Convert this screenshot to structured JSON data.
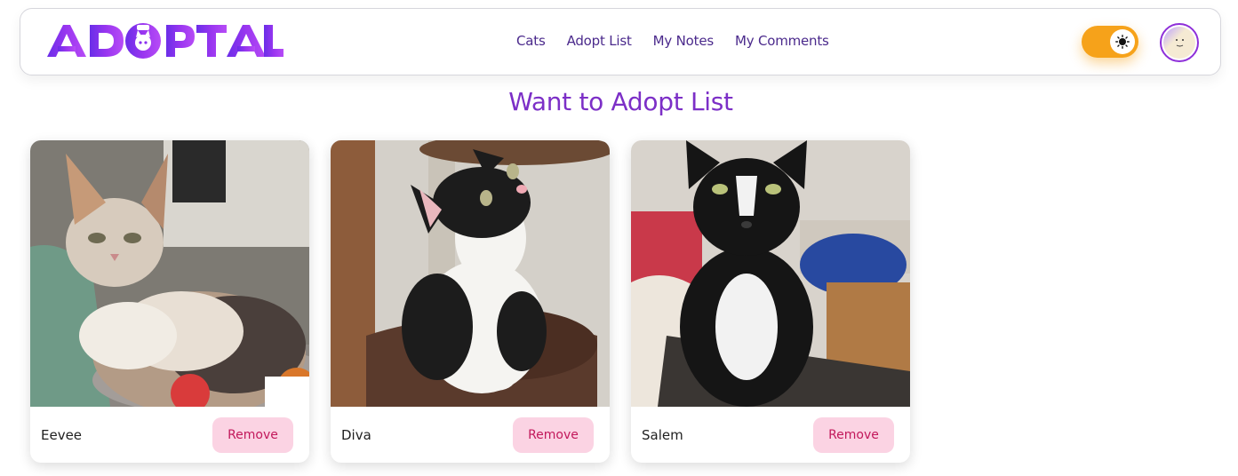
{
  "brand": {
    "logo_text": "ADOPTAL"
  },
  "nav": {
    "links": [
      {
        "label": "Cats"
      },
      {
        "label": "Adopt List"
      },
      {
        "label": "My Notes"
      },
      {
        "label": "My Comments"
      }
    ]
  },
  "theme_toggle": {
    "state": "light",
    "icon": "sun-icon"
  },
  "page": {
    "title": "Want to Adopt List"
  },
  "cards": [
    {
      "name": "Eevee",
      "remove_label": "Remove",
      "photo": "calico cat lying on a blanket"
    },
    {
      "name": "Diva",
      "remove_label": "Remove",
      "photo": "black and white kitten looking up"
    },
    {
      "name": "Salem",
      "remove_label": "Remove",
      "photo": "black and white tuxedo cat sitting"
    }
  ],
  "colors": {
    "brand_purple": "#7c2fc7",
    "toggle_orange": "#f6a21a",
    "remove_bg": "#fbd3e3",
    "remove_text": "#c2185b"
  }
}
